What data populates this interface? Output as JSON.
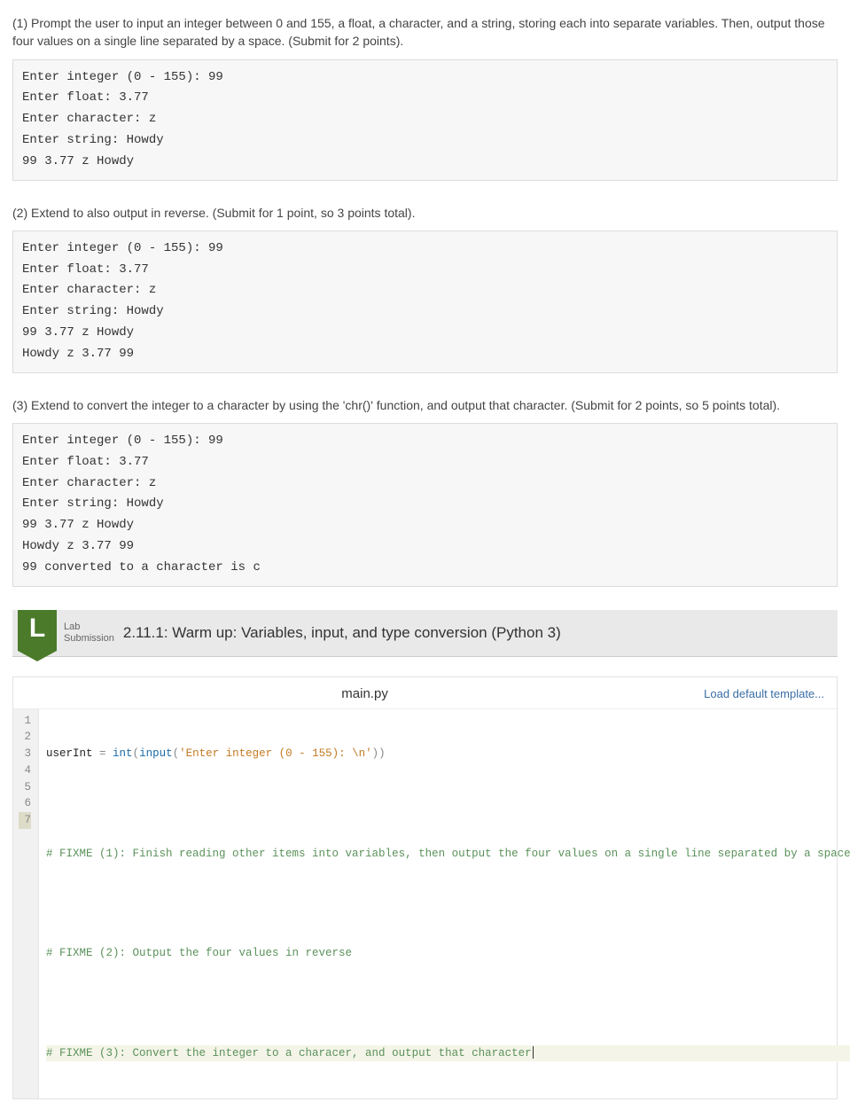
{
  "part1": {
    "text": "(1) Prompt the user to input an integer between 0 and 155, a float, a character, and a string, storing each into separate variables. Then, output those four values on a single line separated by a space. (Submit for 2 points).",
    "sample": "Enter integer (0 - 155): 99\nEnter float: 3.77\nEnter character: z\nEnter string: Howdy\n99 3.77 z Howdy"
  },
  "part2": {
    "text": "(2) Extend to also output in reverse. (Submit for 1 point, so 3 points total).",
    "sample": "Enter integer (0 - 155): 99\nEnter float: 3.77\nEnter character: z\nEnter string: Howdy\n99 3.77 z Howdy\nHowdy z 3.77 99"
  },
  "part3": {
    "text": "(3) Extend to convert the integer to a character by using the 'chr()' function, and output that character. (Submit for 2 points, so 5 points total).",
    "sample": "Enter integer (0 - 155): 99\nEnter float: 3.77\nEnter character: z\nEnter string: Howdy\n99 3.77 z Howdy\nHowdy z 3.77 99\n99 converted to a character is c"
  },
  "lab": {
    "badge": "L",
    "meta1": "Lab",
    "meta2": "Submission",
    "title": "2.11.1: Warm up: Variables, input, and type conversion (Python 3)"
  },
  "editor": {
    "filename": "main.py",
    "loadTemplate": "Load default template...",
    "lineNumbers": [
      "1",
      "2",
      "3",
      "4",
      "5",
      "6",
      "7"
    ],
    "highlightLine": 7,
    "code": {
      "l1": {
        "var": "userInt",
        "eq": " = ",
        "fn1": "int",
        "p1": "(",
        "fn2": "input",
        "p2": "(",
        "str": "'Enter integer (0 - 155): \\n'",
        "p3": "))"
      },
      "l3": "# FIXME (1): Finish reading other items into variables, then output the four values on a single line separated by a space",
      "l5": "# FIXME (2): Output the four values in reverse",
      "l7": "# FIXME (3): Convert the integer to a characer, and output that character"
    }
  }
}
